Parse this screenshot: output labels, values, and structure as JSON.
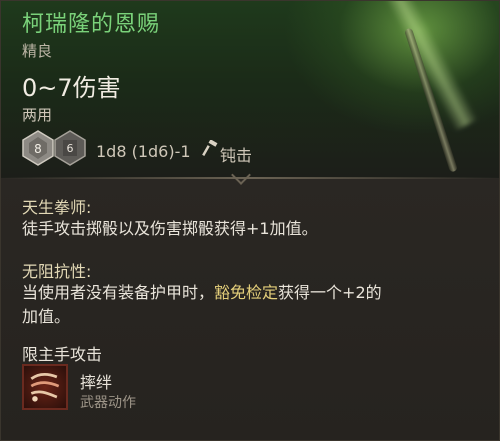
{
  "item": {
    "name": "柯瑞隆的恩赐",
    "rarity": "精良",
    "damage": "0~7伤害",
    "handedness": "两用",
    "dice": [
      {
        "icon": "d8-die-icon",
        "label": "8"
      },
      {
        "icon": "d6-die-icon",
        "label": "6"
      }
    ],
    "dice_formula": "1d8 (1d6)-1",
    "damage_type_icon": "hammer-icon",
    "damage_type": "钝击"
  },
  "passives": [
    {
      "name": "天生拳师:",
      "description": "徒手攻击掷骰以及伤害掷骰获得+1加值。"
    },
    {
      "name": "无阻抗性:",
      "description_pre": "当使用者没有装备护甲时，",
      "description_highlight": "豁免检定",
      "description_post": "获得一个+2的",
      "description_line2": "加值。"
    }
  ],
  "restriction": "限主手攻击",
  "action": {
    "icon": "trip-attack-icon",
    "name": "摔绊",
    "type": "武器动作"
  },
  "colors": {
    "title": "#7ad27a",
    "passive_name": "#e3d9b6",
    "highlight": "#e4cf7a"
  }
}
